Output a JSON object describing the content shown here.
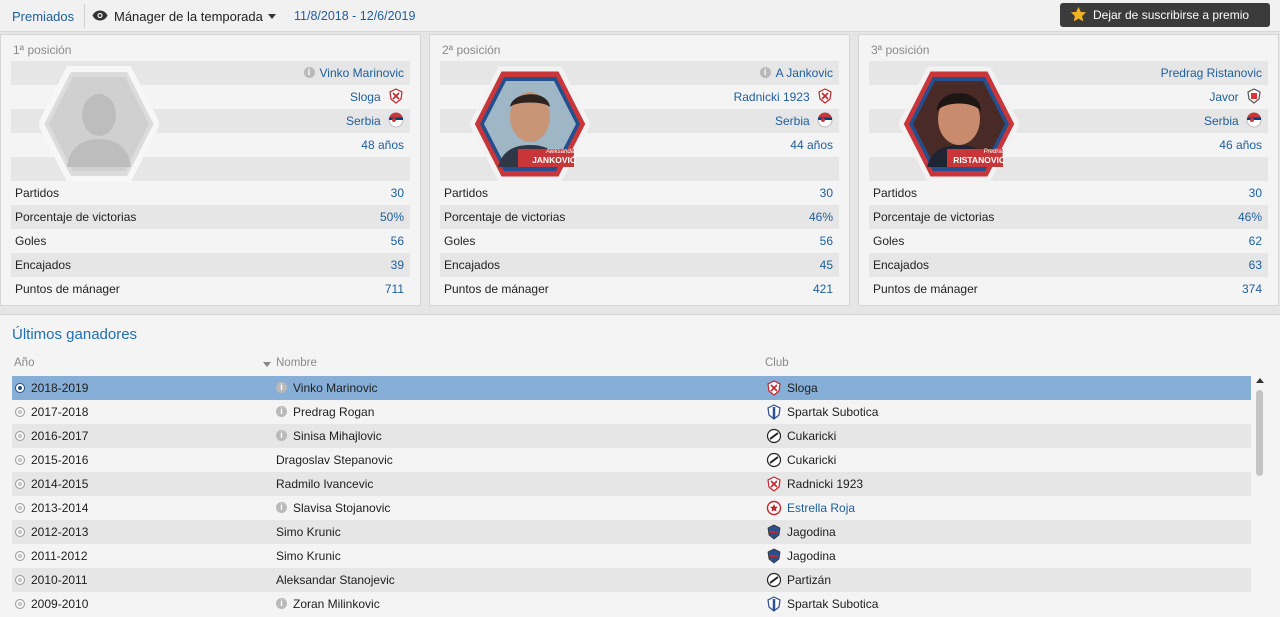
{
  "topbar": {
    "section": "Premiados",
    "award": "Mánager de la temporada",
    "dates": "11/8/2018 - 12/6/2019",
    "unsubscribe": "Dejar de suscribirse a premio"
  },
  "positions": [
    {
      "title": "1ª posición",
      "name": "Vinko Marinovic",
      "club": "Sloga",
      "nation": "Serbia",
      "age": "48 años",
      "caption_first": "",
      "caption_last": "",
      "stats": [
        {
          "label": "Partidos",
          "value": "30"
        },
        {
          "label": "Porcentaje de victorias",
          "value": "50%"
        },
        {
          "label": "Goles",
          "value": "56"
        },
        {
          "label": "Encajados",
          "value": "39"
        },
        {
          "label": "Puntos de mánager",
          "value": "711"
        }
      ]
    },
    {
      "title": "2ª posición",
      "name": "A Jankovic",
      "club": "Radnicki 1923",
      "nation": "Serbia",
      "age": "44 años",
      "caption_first": "Aleksandar",
      "caption_last": "JANKOVIĆ",
      "stats": [
        {
          "label": "Partidos",
          "value": "30"
        },
        {
          "label": "Porcentaje de victorias",
          "value": "46%"
        },
        {
          "label": "Goles",
          "value": "56"
        },
        {
          "label": "Encajados",
          "value": "45"
        },
        {
          "label": "Puntos de mánager",
          "value": "421"
        }
      ]
    },
    {
      "title": "3ª posición",
      "name": "Predrag Ristanovic",
      "club": "Javor",
      "nation": "Serbia",
      "age": "46 años",
      "caption_first": "Predrag",
      "caption_last": "RISTANOVIĆ",
      "stats": [
        {
          "label": "Partidos",
          "value": "30"
        },
        {
          "label": "Porcentaje de victorias",
          "value": "46%"
        },
        {
          "label": "Goles",
          "value": "62"
        },
        {
          "label": "Encajados",
          "value": "63"
        },
        {
          "label": "Puntos de mánager",
          "value": "374"
        }
      ]
    }
  ],
  "winners": {
    "title": "Últimos ganadores",
    "columns": {
      "year": "Año",
      "name": "Nombre",
      "club": "Club"
    },
    "rows": [
      {
        "year": "2018-2019",
        "name": "Vinko Marinovic",
        "info": true,
        "club": "Sloga",
        "selected": true,
        "crest": "crest-red"
      },
      {
        "year": "2017-2018",
        "name": "Predrag Rogan",
        "info": true,
        "club": "Spartak Subotica",
        "crest": "crest-blue-white"
      },
      {
        "year": "2016-2017",
        "name": "Sinisa Mihajlovic",
        "info": true,
        "club": "Cukaricki",
        "crest": "crest-black-white"
      },
      {
        "year": "2015-2016",
        "name": "Dragoslav Stepanovic",
        "info": false,
        "club": "Cukaricki",
        "crest": "crest-black-white"
      },
      {
        "year": "2014-2015",
        "name": "Radmilo Ivancevic",
        "info": false,
        "club": "Radnicki 1923",
        "crest": "crest-red"
      },
      {
        "year": "2013-2014",
        "name": "Slavisa Stojanovic",
        "info": true,
        "club": "Estrella Roja",
        "link": true,
        "crest": "crest-red-star"
      },
      {
        "year": "2012-2013",
        "name": "Simo Krunic",
        "info": false,
        "club": "Jagodina",
        "crest": "crest-blue-red"
      },
      {
        "year": "2011-2012",
        "name": "Simo Krunic",
        "info": false,
        "club": "Jagodina",
        "crest": "crest-blue-red"
      },
      {
        "year": "2010-2011",
        "name": "Aleksandar Stanojevic",
        "info": false,
        "club": "Partizán",
        "crest": "crest-black-white"
      },
      {
        "year": "2009-2010",
        "name": "Zoran Milinkovic",
        "info": true,
        "club": "Spartak Subotica",
        "crest": "crest-blue-white"
      }
    ]
  },
  "colors": {
    "accent": "#1f5e9c",
    "selected_row": "#86aed6",
    "button_bg": "#3b3b3b"
  }
}
